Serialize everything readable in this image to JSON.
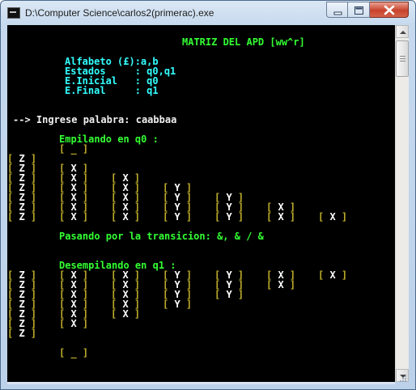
{
  "window": {
    "title": "D:\\Computer Science\\carlos2(primerac).exe"
  },
  "console": {
    "header": "MATRIZ DEL APD [ww^r]",
    "info": [
      "Alfabeto (£):a,b",
      "Estados     : q0,q1",
      "E.Inicial   : q0",
      "E.Final     : q1"
    ],
    "prompt": "--> Ingrese palabra: caabbaa",
    "push_heading": "Empilando en q0 :",
    "push_empty": "[ _ ]",
    "push_rows": [
      [
        "Z",
        "",
        "",
        "",
        "",
        "",
        ""
      ],
      [
        "Z",
        "X",
        "",
        "",
        "",
        "",
        ""
      ],
      [
        "Z",
        "X",
        "X",
        "",
        "",
        "",
        ""
      ],
      [
        "Z",
        "X",
        "X",
        "Y",
        "",
        "",
        ""
      ],
      [
        "Z",
        "X",
        "X",
        "Y",
        "Y",
        "",
        ""
      ],
      [
        "Z",
        "X",
        "X",
        "Y",
        "Y",
        "X",
        ""
      ],
      [
        "Z",
        "X",
        "X",
        "Y",
        "Y",
        "X",
        "X"
      ]
    ],
    "transition": "Pasando por la transicion: &, & / &",
    "pop_heading": "Desempilando en q1 :",
    "pop_columns": [
      [
        "Z",
        "Z",
        "Z",
        "Z",
        "Z",
        "Z",
        "Z"
      ],
      [
        "X",
        "X",
        "X",
        "X",
        "X",
        "X"
      ],
      [
        "X",
        "X",
        "X",
        "X",
        "X"
      ],
      [
        "Y",
        "Y",
        "Y",
        "Y"
      ],
      [
        "Y",
        "Y",
        "Y"
      ],
      [
        "X",
        "X"
      ],
      [
        "X"
      ]
    ],
    "pop_empty": "[ _ ]"
  }
}
